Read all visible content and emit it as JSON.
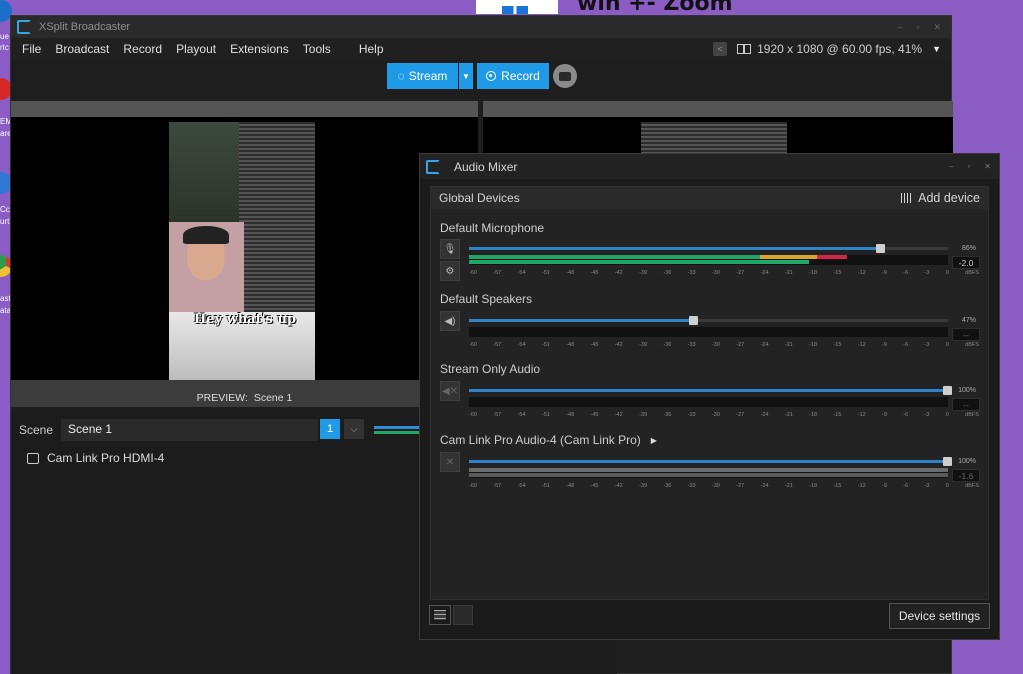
{
  "desktop": {
    "zoom_title": "win +- Zoom",
    "icon_texts": [
      "ue",
      "rtc",
      "EM",
      "are",
      "Cc",
      "urt",
      "ast",
      "ata"
    ]
  },
  "main_window": {
    "title": "XSplit Broadcaster",
    "window_controls": [
      "–",
      "▫",
      "✕"
    ],
    "menu": [
      "File",
      "Broadcast",
      "Record",
      "Playout",
      "Extensions",
      "Tools",
      "Help"
    ],
    "resolution": "1920 x 1080 @ 60.00 fps, 41%",
    "stream_label": "Stream",
    "record_label": "Record",
    "preview_label": "PREVIEW:",
    "preview_scene": "Scene 1",
    "video_caption": "Hey what's up",
    "scene_label": "Scene",
    "scene_value": "Scene 1",
    "scene_number": "1",
    "source_name": "Cam Link Pro HDMI-4"
  },
  "mixer": {
    "title": "Audio Mixer",
    "window_controls": [
      "–",
      "▫",
      "✕"
    ],
    "section_title": "Global Devices",
    "add_device_label": "Add device",
    "scale": [
      "-60",
      "-57",
      "-54",
      "-51",
      "-48",
      "-45",
      "-42",
      "-39",
      "-36",
      "-33",
      "-30",
      "-27",
      "-24",
      "-21",
      "-18",
      "-15",
      "-12",
      "-9",
      "-6",
      "-3",
      "0",
      "dBFS"
    ],
    "devices": [
      {
        "name": "Default Microphone",
        "volume_pct": "86%",
        "level_db": "-2.0",
        "volume_fraction": 0.86
      },
      {
        "name": "Default Speakers",
        "volume_pct": "47%",
        "level_db": "--",
        "volume_fraction": 0.47
      },
      {
        "name": "Stream Only Audio",
        "volume_pct": "100%",
        "level_db": "--",
        "volume_fraction": 1.0
      },
      {
        "name": "Cam Link Pro Audio-4 (Cam Link Pro)",
        "volume_pct": "100%",
        "level_db": "-1.6",
        "volume_fraction": 1.0
      }
    ],
    "device_settings_label": "Device settings"
  },
  "colors": {
    "accent": "#1e9ae6",
    "slider": "#2f84c9",
    "meter_green": "#21a66a",
    "meter_yellow": "#d9a62a",
    "meter_red": "#d3264c",
    "desktop": "#8a5cc4"
  }
}
